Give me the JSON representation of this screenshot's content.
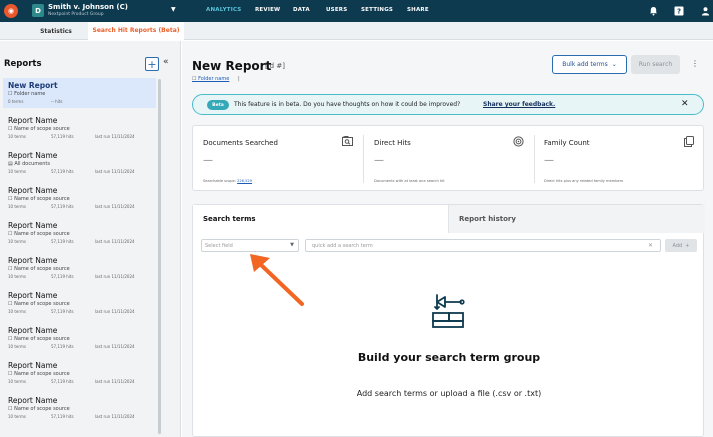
{
  "colors": {
    "topbar": "#0e3a4f",
    "accent_orange": "#e8612c",
    "nav_active": "#59c3d9",
    "primary_blue": "#2b6cb0",
    "beta_teal": "#36a9b9",
    "arrow": "#f26522"
  },
  "topbar": {
    "logo_icon": "brand-logo-icon",
    "case_badge": "D",
    "case_name": "Smith v. Johnson (C)",
    "case_group": "Nextpoint Product Group",
    "nav": [
      "ANALYTICS",
      "REVIEW",
      "DATA",
      "USERS",
      "SETTINGS",
      "SHARE"
    ],
    "active_nav": "ANALYTICS",
    "icons": [
      "bell-icon",
      "help-icon",
      "user-icon"
    ]
  },
  "subtabs": [
    "Statistics",
    "Search Hit Reports (Beta)"
  ],
  "sidebar": {
    "title": "Reports",
    "add_icon": "plus-icon",
    "collapse_icon": "double-chevron-left-icon",
    "items": [
      {
        "title": "New Report",
        "sub": "Folder name",
        "terms": "0 terms",
        "hits": "-- hits",
        "last_run": ""
      },
      {
        "title": "Report Name",
        "sub": "Name of scope source",
        "terms": "10 terms",
        "hits": "57,119 hits",
        "last_run": "last run 11/11/2024"
      },
      {
        "title": "Report Name",
        "sub": "All documents",
        "terms": "10 terms",
        "hits": "57,119 hits",
        "last_run": "last run 11/11/2024"
      },
      {
        "title": "Report Name",
        "sub": "Name of scope source",
        "terms": "10 terms",
        "hits": "57,119 hits",
        "last_run": "last run 11/11/2024"
      },
      {
        "title": "Report Name",
        "sub": "Name of scope source",
        "terms": "10 terms",
        "hits": "57,119 hits",
        "last_run": "last run 11/11/2024"
      },
      {
        "title": "Report Name",
        "sub": "Name of scope source",
        "terms": "10 terms",
        "hits": "57,119 hits",
        "last_run": "last run 11/11/2024"
      },
      {
        "title": "Report Name",
        "sub": "Name of scope source",
        "terms": "10 terms",
        "hits": "57,119 hits",
        "last_run": "last run 11/11/2024"
      },
      {
        "title": "Report Name",
        "sub": "Name of scope source",
        "terms": "10 terms",
        "hits": "57,119 hits",
        "last_run": "last run 11/11/2024"
      },
      {
        "title": "Report Name",
        "sub": "Name of scope source",
        "terms": "10 terms",
        "hits": "57,119 hits",
        "last_run": "last run 11/11/2024"
      },
      {
        "title": "Report Name",
        "sub": "Name of scope source",
        "terms": "10 terms",
        "hits": "57,119 hits",
        "last_run": "last run 11/11/2024"
      }
    ]
  },
  "main": {
    "title": "New Report",
    "id_label": "[id #]",
    "folder_link": "Folder name",
    "folder_sep": "|",
    "bulk_add_label": "Bulk add terms",
    "run_search_label": "Run search",
    "beta": {
      "badge": "Beta",
      "message": "This feature is in beta. Do you have thoughts on how it could be improved?",
      "link": "Share your feedback."
    },
    "stats": [
      {
        "title": "Documents Searched",
        "value": "—",
        "caption_prefix": "Searchable scope:",
        "caption_link": "226,529",
        "icon": "search-document-icon"
      },
      {
        "title": "Direct Hits",
        "value": "—",
        "caption_prefix": "Documents with at least one search hit",
        "caption_link": "",
        "icon": "target-icon"
      },
      {
        "title": "Family Count",
        "value": "—",
        "caption_prefix": "Direct hits plus any related family members",
        "caption_link": "",
        "icon": "copy-icon"
      }
    ],
    "tabs": [
      "Search terms",
      "Report history"
    ],
    "field_placeholder": "Select field",
    "term_placeholder": "quick add a search term",
    "add_label": "Add",
    "empty_title": "Build your search term group",
    "empty_subtitle": "Add search terms or upload a file (.csv or .txt)"
  }
}
